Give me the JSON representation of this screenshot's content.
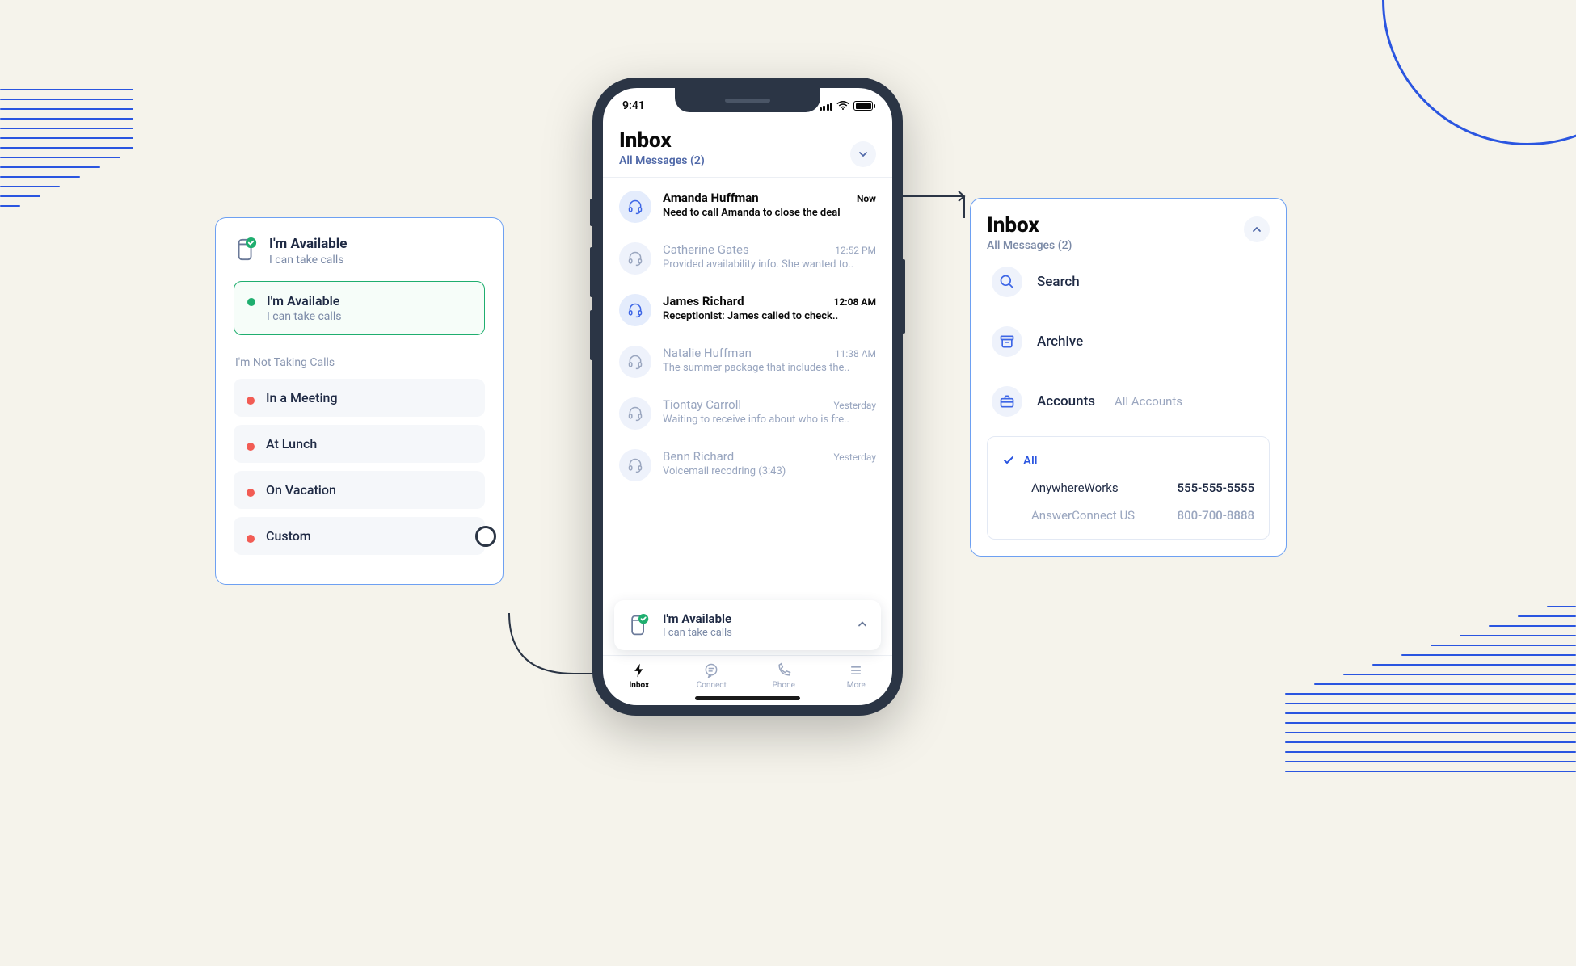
{
  "status_card": {
    "current": {
      "title": "I'm Available",
      "subtitle": "I can take calls"
    },
    "selected": {
      "title": "I'm Available",
      "subtitle": "I can take calls"
    },
    "section_label": "I'm Not Taking Calls",
    "options": [
      {
        "label": "In a Meeting"
      },
      {
        "label": "At Lunch"
      },
      {
        "label": "On Vacation"
      },
      {
        "label": "Custom"
      }
    ]
  },
  "phone": {
    "time": "9:41",
    "header": {
      "title": "Inbox",
      "subtitle": "All Messages (2)"
    },
    "messages": [
      {
        "name": "Amanda Huffman",
        "preview": "Need to call Amanda to close the deal",
        "time": "Now",
        "unread": true
      },
      {
        "name": "Catherine Gates",
        "preview": "Provided availability info. She wanted to..",
        "time": "12:52 PM",
        "unread": false
      },
      {
        "name": "James Richard",
        "preview": "Receptionist: James called to check..",
        "time": "12:08 AM",
        "unread": true
      },
      {
        "name": "Natalie Huffman",
        "preview": "The summer package that includes the..",
        "time": "11:38 AM",
        "unread": false
      },
      {
        "name": "Tiontay Carroll",
        "preview": "Waiting to receive info about who is fre..",
        "time": "Yesterday",
        "unread": false
      },
      {
        "name": "Benn Richard",
        "preview": "Voicemail recodring (3:43)",
        "time": "Yesterday",
        "unread": false
      }
    ],
    "avail": {
      "title": "I'm Available",
      "subtitle": "I can take calls"
    },
    "tabs": [
      {
        "label": "Inbox"
      },
      {
        "label": "Connect"
      },
      {
        "label": "Phone"
      },
      {
        "label": "More"
      }
    ]
  },
  "inbox_card": {
    "title": "Inbox",
    "subtitle": "All Messages (2)",
    "menu": {
      "search": "Search",
      "archive": "Archive",
      "accounts": "Accounts",
      "accounts_hint": "All Accounts"
    },
    "accounts": {
      "all": "All",
      "rows": [
        {
          "name": "AnywhereWorks",
          "number": "555-555-5555",
          "muted": false
        },
        {
          "name": "AnswerConnect US",
          "number": "800-700-8888",
          "muted": true
        }
      ]
    }
  }
}
